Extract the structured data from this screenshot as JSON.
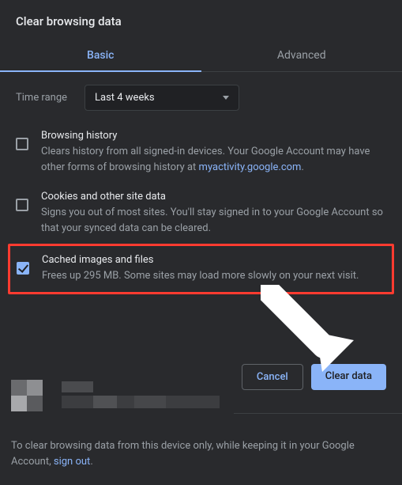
{
  "dialog": {
    "title": "Clear browsing data",
    "tabs": {
      "basic": "Basic",
      "advanced": "Advanced"
    },
    "time_range": {
      "label": "Time range",
      "value": "Last 4 weeks"
    },
    "options": {
      "history": {
        "title": "Browsing history",
        "desc_1": "Clears history from all signed-in devices. Your Google Account may have other forms of browsing history at ",
        "link": "myactivity.google.com",
        "desc_2": "."
      },
      "cookies": {
        "title": "Cookies and other site data",
        "desc": "Signs you out of most sites. You'll stay signed in to your Google Account so that your synced data can be cleared."
      },
      "cache": {
        "title": "Cached images and files",
        "desc": "Frees up 295 MB. Some sites may load more slowly on your next visit."
      }
    },
    "buttons": {
      "cancel": "Cancel",
      "clear": "Clear data"
    },
    "footer": {
      "text_1": "To clear browsing data from this device only, while keeping it in your Google Account, ",
      "link": "sign out",
      "text_2": "."
    }
  }
}
